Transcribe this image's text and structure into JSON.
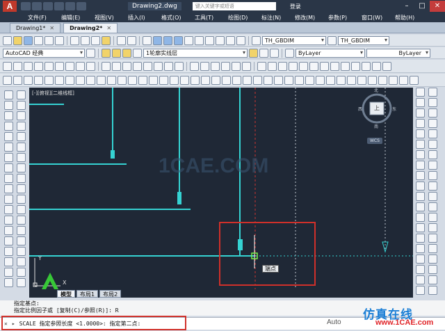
{
  "window": {
    "logo_text": "A",
    "doc_title": "Drawing2.dwg",
    "search_placeholder": "键入关键字或短语",
    "login": "登录",
    "min": "–",
    "max": "□",
    "close": "✕"
  },
  "menu": {
    "items": [
      "文件(F)",
      "编辑(E)",
      "视图(V)",
      "插入(I)",
      "格式(O)",
      "工具(T)",
      "绘图(D)",
      "标注(N)",
      "修改(M)",
      "参数(P)",
      "窗口(W)",
      "帮助(H)"
    ]
  },
  "doc_tabs": [
    {
      "label": "Drawing1*",
      "active": false
    },
    {
      "label": "Drawing2*",
      "active": true
    }
  ],
  "toolbar": {
    "workspace": "AutoCAD 经典",
    "layer": "1轮廓实线层",
    "dimstyle_1": "TH_GBDIM",
    "dimstyle_2": "TH_GBDIM",
    "color": "ByLayer",
    "linetype": "ByLayer"
  },
  "viewport": {
    "label": "[-][俯视][二维线框]",
    "viewcube_top": "北",
    "viewcube_bottom": "南",
    "viewcube_left": "西",
    "viewcube_right": "东",
    "viewcube_face": "上",
    "wcs": "WCS",
    "ucs_y": "Y",
    "ucs_x": "X",
    "watermark": "1CAE.COM",
    "tooltip": "端点"
  },
  "layout_tabs": [
    "模型",
    "布局1",
    "布局2"
  ],
  "command": {
    "history_1": "指定基点:",
    "history_2": "指定比例因子或 [复制(C)/参照(R)]: R",
    "current": "SCALE 指定参照长度 <1.0000>:  指定第二点:"
  },
  "watermark_brand": {
    "cn": "仿真在线",
    "url": "www.1CAE.com",
    "wechat": "Auto"
  },
  "colors": {
    "canvas": "#1f2836",
    "geometry": "#35d3d3",
    "highlight_box": "#d0302a"
  }
}
